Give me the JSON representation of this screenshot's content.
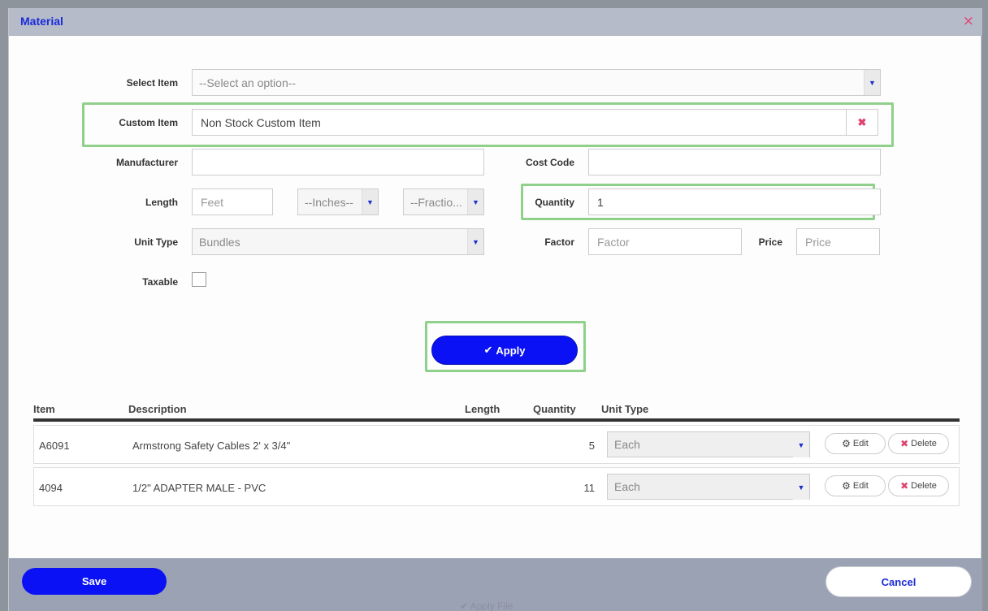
{
  "modal": {
    "title": "Material",
    "close_icon": "×"
  },
  "form": {
    "select_item": {
      "label": "Select Item",
      "value": "--Select an option--"
    },
    "custom_item": {
      "label": "Custom Item",
      "value": "Non Stock Custom Item",
      "clear_icon": "✖"
    },
    "manufacturer": {
      "label": "Manufacturer",
      "value": ""
    },
    "cost_code": {
      "label": "Cost Code",
      "value": ""
    },
    "length": {
      "label": "Length",
      "feet_placeholder": "Feet",
      "inches": "--Inches--",
      "fraction": "--Fractio..."
    },
    "quantity": {
      "label": "Quantity",
      "value": "1"
    },
    "unit_type": {
      "label": "Unit Type",
      "value": "Bundles"
    },
    "factor": {
      "label": "Factor",
      "placeholder": "Factor"
    },
    "price": {
      "label": "Price",
      "placeholder": "Price"
    },
    "taxable": {
      "label": "Taxable",
      "checked": false
    },
    "apply_label": "Apply",
    "apply_icon": "✔"
  },
  "table": {
    "headers": {
      "item": "Item",
      "description": "Description",
      "length": "Length",
      "quantity": "Quantity",
      "unit_type": "Unit Type"
    },
    "rows": [
      {
        "item": "A6091",
        "description": "Armstrong Safety Cables 2' x 3/4\"",
        "length": "",
        "quantity": "5",
        "unit_type": "Each",
        "edit": "Edit",
        "delete": "Delete"
      },
      {
        "item": "4094",
        "description": "1/2\" ADAPTER MALE - PVC",
        "length": "",
        "quantity": "11",
        "unit_type": "Each",
        "edit": "Edit",
        "delete": "Delete"
      }
    ]
  },
  "footer": {
    "save_label": "Save",
    "cancel_label": "Cancel",
    "ghost_text": "✔ Apply File"
  },
  "icons": {
    "dropdown": "▼",
    "gear": "⚙",
    "x": "✖"
  },
  "colors": {
    "accent": "#0a12f5",
    "header_bg": "#b5bbc9",
    "highlight": "#8fd18a",
    "danger": "#e0436f"
  }
}
